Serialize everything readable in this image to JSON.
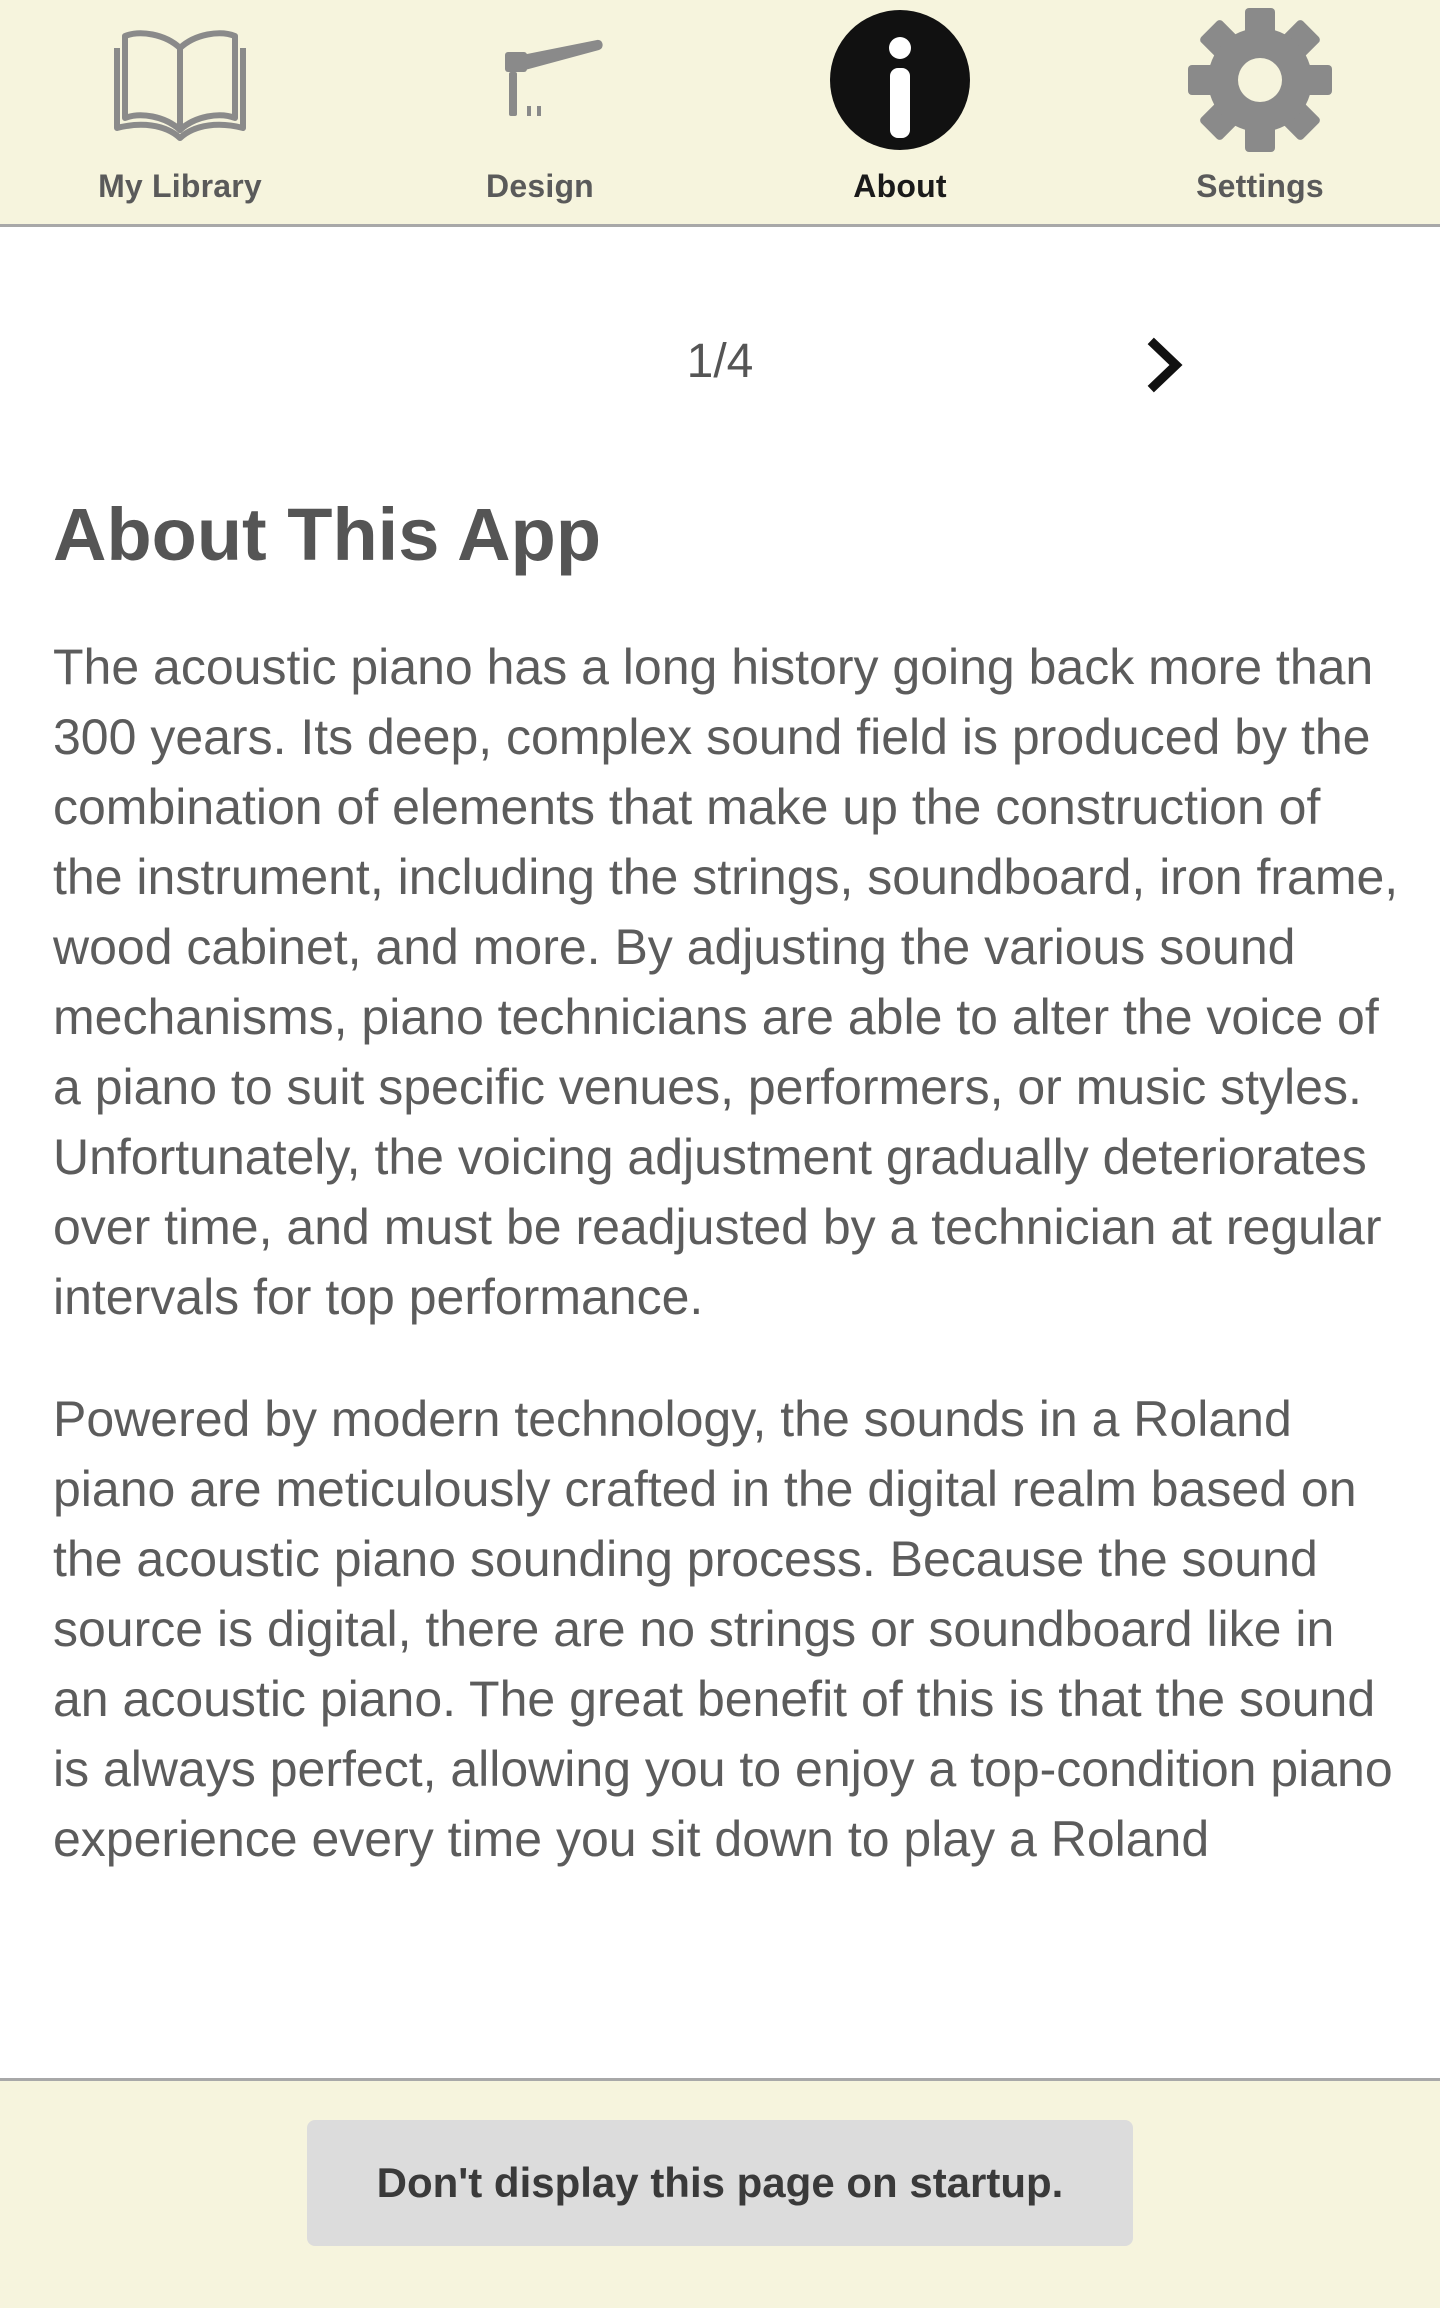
{
  "tabs": [
    {
      "label": "My Library",
      "icon": "book-icon",
      "active": false
    },
    {
      "label": "Design",
      "icon": "hammer-icon",
      "active": false
    },
    {
      "label": "About",
      "icon": "info-icon",
      "active": true
    },
    {
      "label": "Settings",
      "icon": "gear-icon",
      "active": false
    }
  ],
  "pager": {
    "indicator": "1/4",
    "next_icon": "chevron-right-icon"
  },
  "about": {
    "title": "About This App",
    "paragraphs": [
      "The acoustic piano has a long history going back more than 300 years. Its deep, complex sound field is produced by the combination of elements that make up the construction of the instrument, including the strings, soundboard, iron frame, wood cabinet, and more. By adjusting the various sound mechanisms, piano technicians are able to alter the voice of a piano to suit specific venues, performers, or music styles. Unfortunately, the voicing adjustment gradually deteriorates over time, and must be readjusted by a technician at regular intervals for top performance.",
      "Powered by modern technology, the sounds in a Roland piano are meticulously crafted in the digital realm based on the acoustic piano sounding process. Because the sound source is digital, there are no strings or soundboard like in an acoustic piano. The great benefit of this is that the sound is always perfect, allowing you to enjoy a top-condition piano experience every time you sit down to play a Roland"
    ]
  },
  "footer": {
    "button_label": "Don't display this page on startup."
  },
  "colors": {
    "bar_background": "#f6f4dd",
    "icon_gray": "#8a8a8a",
    "icon_active": "#111111",
    "button_background": "#dcdcdc"
  }
}
